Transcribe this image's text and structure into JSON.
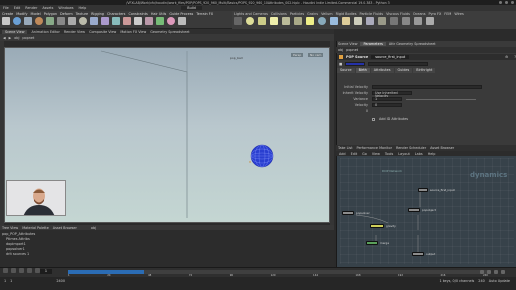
{
  "window": {
    "title": "/VFXLAB/Work/vfx/houdini/work_files/POP/POPS_920_960_Multi/Basics/POPS_920_960_10Attributes_002.hiplc - Houdini Indie Limited-Commercial 19.0.383 - Python 3"
  },
  "menubar": {
    "items": [
      "File",
      "Edit",
      "Render",
      "Assets",
      "Windows",
      "Help"
    ],
    "desktop": "Build"
  },
  "shelf": {
    "tabs": [
      "Create",
      "Modify",
      "Model",
      "Polygon",
      "Deform",
      "Texture",
      "Rigging",
      "Characters",
      "Constraints",
      "Hair Utils",
      "Guide Process",
      "Terrain FX"
    ],
    "tools": [
      "Box",
      "Sphere",
      "Tube",
      "Torus",
      "Grid",
      "Null",
      "Line",
      "Circle",
      "Curve",
      "Draw Curve",
      "Path",
      "Spray Paint",
      "Font",
      "Platonic Solids",
      "L-System",
      "Metaball",
      "File"
    ],
    "right_tabs": [
      "Lights and Cameras",
      "Collisions",
      "Particles",
      "Grains",
      "Vellum",
      "Rigid Bodies",
      "Particle Fluids",
      "Viscous Fluids",
      "Oceans",
      "Pyro FX",
      "FEM",
      "Wires"
    ],
    "right_tools": [
      "Camera",
      "Point Light",
      "Spot Light",
      "Area Light",
      "Geometry Light",
      "Volume Light",
      "Distant Light",
      "Environment Light",
      "Sky Light",
      "GI Light",
      "Caustic Light",
      "Portal Light",
      "Ambient Light",
      "Stereo Camera",
      "VR Camera",
      "Switcher",
      "Gamepad Camera"
    ]
  },
  "viewport": {
    "tabs": [
      "Scene View",
      "Animation Editor",
      "Render View",
      "Composite View",
      "Motion FX View",
      "Geometry Spreadsheet"
    ],
    "path": "obj",
    "node": "popnet",
    "view_label": "Persp",
    "camera_label": "No cam",
    "ball_label": "pop_ball"
  },
  "network_lower_left": {
    "tabs": [
      "Tree View",
      "Material Palette",
      "Asset Browser"
    ],
    "path": "obj",
    "items": [
      "pop_POP_Attributes",
      "Ptimes Attribs",
      "dopimport1",
      "popsolver1",
      "drit sources 1"
    ]
  },
  "timeline": {
    "frame": "1",
    "start": "1",
    "end": "240",
    "range_end": "2400",
    "progress": 0.18,
    "ticks": [
      "24",
      "48",
      "72",
      "96",
      "120",
      "144",
      "168",
      "192",
      "216",
      "240"
    ]
  },
  "bottom": {
    "fps_label": "Auto Update",
    "range_label": "240",
    "right_label": "1 keys, 0/0 channels"
  },
  "parameters": {
    "tabs": [
      "Scene View",
      "Parameters",
      "Attr Geometry Spreadsheet"
    ],
    "path": "obj",
    "path_node": "popnet",
    "node_type": "POP Source",
    "node_name": "source_first_input",
    "tabs_sub": [
      "Source",
      "Birth",
      "Attributes",
      "Guides",
      "Birthright"
    ],
    "active_sub": "Birth",
    "rows": [
      {
        "label": "Initial Velocity",
        "value": "Use Inherited Velocity"
      },
      {
        "label": "Inherit Velocity",
        "value": "1"
      },
      {
        "label": "Variance",
        "value": "0"
      },
      {
        "label": "Velocity",
        "value": "0"
      },
      {
        "label": "",
        "value": "Add ID Attributes"
      }
    ]
  },
  "node_editor": {
    "tabs": [
      "Take List",
      "Performance Monitor",
      "Render Scheduler",
      "Asset Browser"
    ],
    "menu": [
      "Add",
      "Edit",
      "Go",
      "View",
      "Tools",
      "Layout",
      "Labs",
      "Help"
    ],
    "context": "DOP Network",
    "watermark": "dynamics",
    "nodes": [
      {
        "name": "source_first_input",
        "color": "#8c8c8c"
      },
      {
        "name": "popsolver",
        "color": "#8c8c8c"
      },
      {
        "name": "popobject",
        "color": "#8c8c8c"
      },
      {
        "name": "gravity",
        "color": "#cfcf5a"
      },
      {
        "name": "output",
        "color": "#8c8c8c"
      },
      {
        "name": "merge",
        "color": "#5aa05a"
      }
    ]
  },
  "colors": {
    "accent": "#2b6cb4",
    "viewport_top": "#9aabb7",
    "viewport_bottom": "#c4d6d2",
    "ball": "#2a3fd0"
  }
}
